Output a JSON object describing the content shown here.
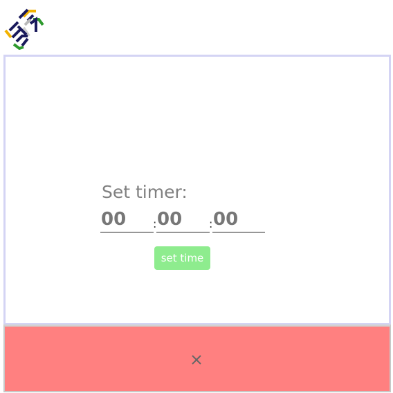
{
  "logo": {
    "name": "logo-icon"
  },
  "timer": {
    "label": "Set timer:",
    "hours_placeholder": "00",
    "minutes_placeholder": "00",
    "seconds_placeholder": "00",
    "separator": ":"
  },
  "button": {
    "label": "set time"
  },
  "colors": {
    "panel_border": "#d4d4f4",
    "button_bg": "#8eec8e",
    "bottom_bar_bg": "#ff8080"
  },
  "bottom_bar": {
    "icon": "close-icon"
  }
}
